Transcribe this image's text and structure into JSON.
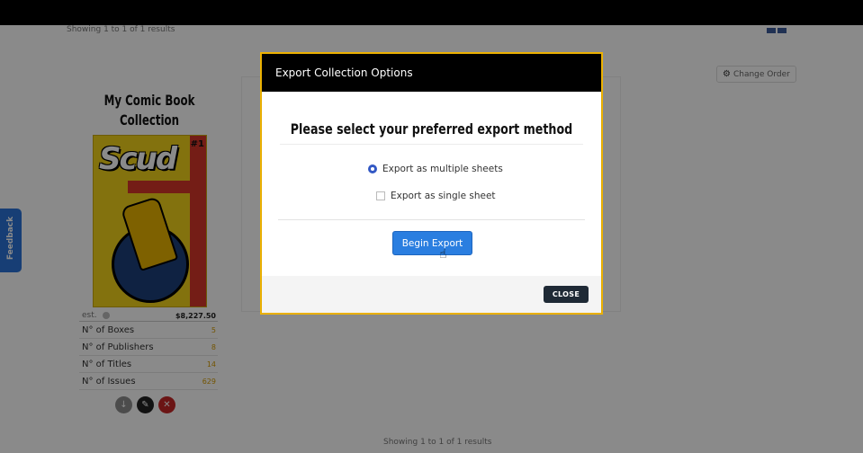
{
  "header": {
    "results_top": "Showing 1 to 1 of 1 results",
    "results_bottom": "Showing 1 to 1 of 1 results"
  },
  "toolbar": {
    "change_order_label": "Change Order",
    "change_order_icon": "gear-icon"
  },
  "collection": {
    "title": "My Comic Book Collection",
    "cover": {
      "logo": "Scud",
      "issue_badge": "#1"
    },
    "est_label": "est.",
    "est_value": "$8,227.50",
    "stats": [
      {
        "label": "N° of Boxes",
        "value": "5"
      },
      {
        "label": "N° of Publishers",
        "value": "8"
      },
      {
        "label": "N° of Titles",
        "value": "14"
      },
      {
        "label": "N° of Issues",
        "value": "629"
      }
    ],
    "actions": {
      "download_icon": "download-icon",
      "edit_icon": "pencil-icon",
      "delete_icon": "close-icon"
    }
  },
  "feedback": {
    "label": "Feedback"
  },
  "modal": {
    "title": "Export Collection Options",
    "prompt": "Please select your preferred export method",
    "options": [
      {
        "label": "Export as multiple sheets",
        "selected": true
      },
      {
        "label": "Export as single sheet",
        "selected": false
      }
    ],
    "begin_label": "Begin Export",
    "close_label": "CLOSE"
  },
  "colors": {
    "accent": "#2a7ee0",
    "modal_border": "#e6ac00",
    "stat_value": "#d59b00",
    "delete": "#c62828"
  }
}
